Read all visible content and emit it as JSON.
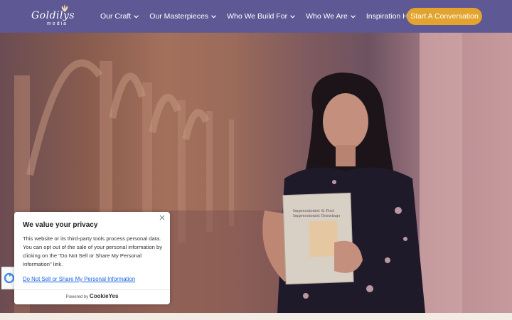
{
  "nav": {
    "logo_name": "Goldilys",
    "logo_sub": "media",
    "menu": [
      {
        "label": "Our Craft"
      },
      {
        "label": "Our Masterpieces"
      },
      {
        "label": "Who We Build For"
      },
      {
        "label": "Who We Are"
      },
      {
        "label": "Inspiration Hub"
      }
    ],
    "cta": "Start A Conversation"
  },
  "book": {
    "title": "Impressionist & Post Impressionist Drawings"
  },
  "cookie": {
    "title": "We value your privacy",
    "body": "This website or its third-party tools process personal data. You can opt out of the sale of your personal information by clicking on the \"Do Not Sell or Share My Personal Information\" link.",
    "link": "Do Not Sell or Share My Personal Information",
    "powered_by": "Powered by",
    "brand": "CookieYes",
    "close_icon": "close-icon"
  },
  "colors": {
    "nav_bg": "#5e5894",
    "cta_bg": "#e3a32f",
    "link": "#1863dc"
  }
}
